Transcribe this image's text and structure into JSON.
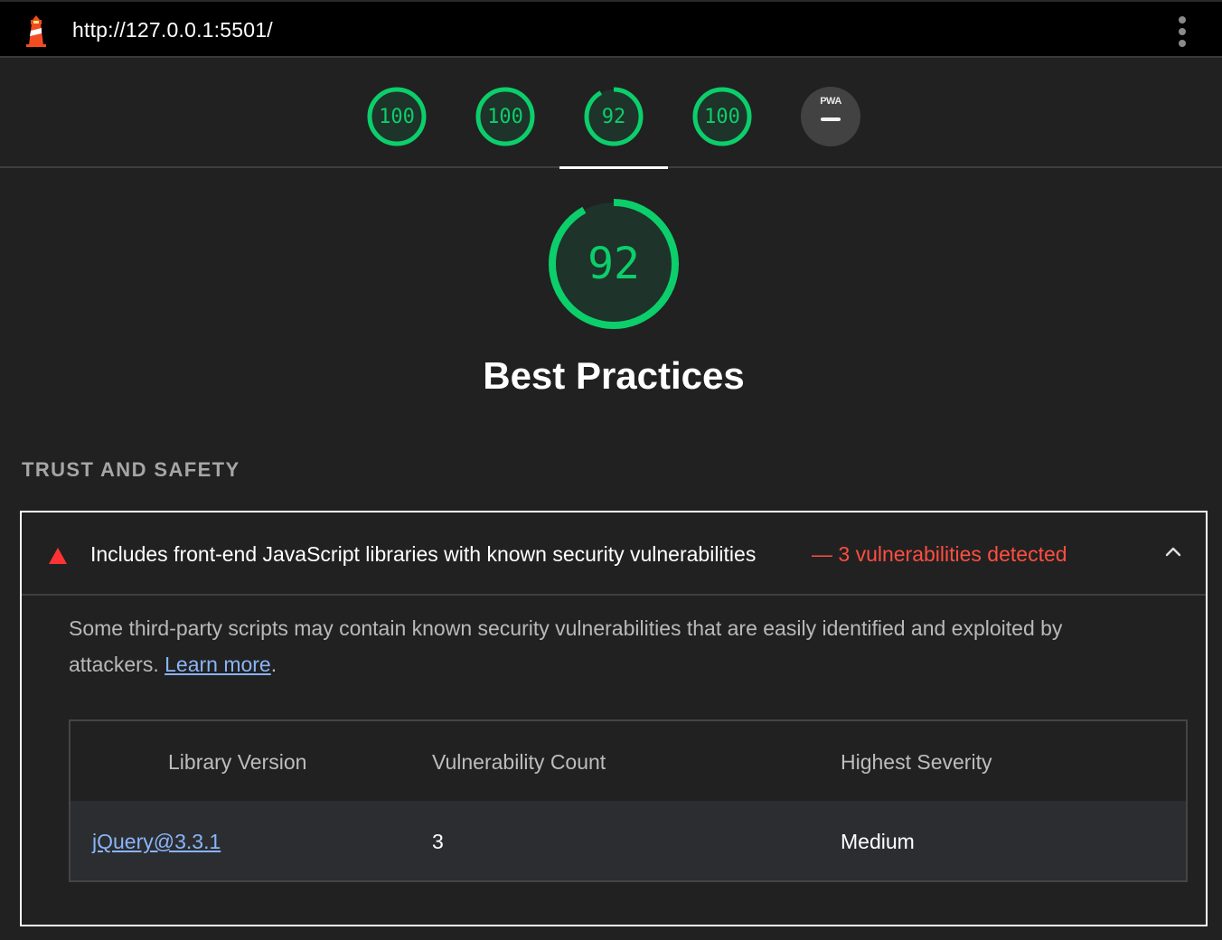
{
  "topbar": {
    "url": "http://127.0.0.1:5501/",
    "logo_icon": "lighthouse-icon",
    "menu_icon": "kebab-menu-icon"
  },
  "gauges": [
    {
      "score": "100",
      "value": 100
    },
    {
      "score": "100",
      "value": 100
    },
    {
      "score": "92",
      "value": 92
    },
    {
      "score": "100",
      "value": 100
    }
  ],
  "pwa": {
    "label": "PWA"
  },
  "category": {
    "score": "92",
    "value": 92,
    "title": "Best Practices"
  },
  "group": {
    "title": "TRUST AND SAFETY"
  },
  "audit": {
    "title": "Includes front-end JavaScript libraries with known security vulnerabilities",
    "display_value": "— 3 vulnerabilities detected",
    "description": "Some third-party scripts may contain known security vulnerabilities that are easily identified and exploited by attackers.",
    "learn_more": "Learn more",
    "period": ".",
    "table": {
      "headers": [
        "Library Version",
        "Vulnerability Count",
        "Highest Severity"
      ],
      "rows": [
        {
          "library": "jQuery@3.3.1",
          "count": "3",
          "severity": "Medium"
        }
      ]
    }
  },
  "colors": {
    "pass": "#0cce6b",
    "fail": "#ff4e42",
    "background": "#212121",
    "link": "#8ab4f8"
  }
}
